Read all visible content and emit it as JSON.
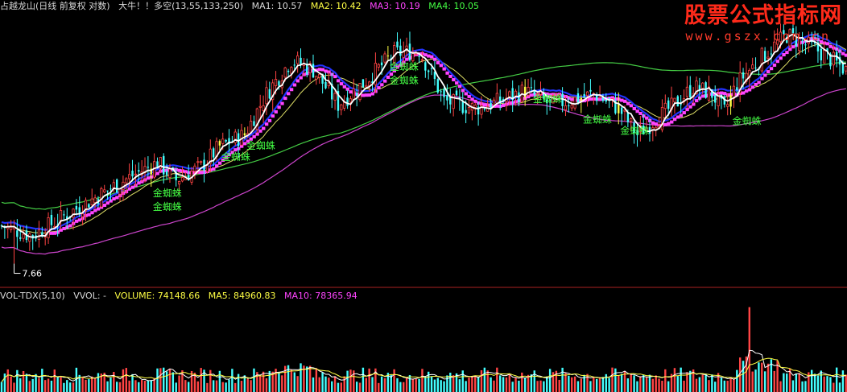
{
  "header": {
    "title": "占越龙山(日线 前复权 对数)",
    "indicator_name": "大牛！！多空(13,55,133,250)",
    "ma1": "MA1: 10.57",
    "ma2": "MA2: 10.42",
    "ma3": "MA3: 10.19",
    "ma4": "MA4: 10.05"
  },
  "volume_header": {
    "name": "VOL-TDX(5,10)",
    "vvol": "VVOL: -",
    "volume": "VOLUME: 74148.66",
    "ma5": "MA5: 84960.83",
    "ma10": "MA10: 78365.94"
  },
  "watermark": {
    "brand": "股票公式指标网",
    "url": "www.gszx.com.cn"
  },
  "colors": {
    "background": "#000000",
    "up": "#ff4444",
    "down": "#44ffff",
    "signal_bar": "#ffff44",
    "signal_text": "#44ff44",
    "ma_fast": "#ffffff",
    "band": "#ff44ff",
    "ma_blue": "#2233ff",
    "ma_yellow": "#dddd66",
    "ma_green": "#44cc44",
    "ma_magenta": "#cc44cc",
    "separator": "#aa2222"
  },
  "chart_data": {
    "type": "candlestick",
    "scale": "log",
    "price_range": [
      7.3,
      14.2
    ],
    "low_label": "7.66",
    "signal_label": "金蜘蛛",
    "close_anchors": [
      [
        0,
        8.4
      ],
      [
        10,
        8.2
      ],
      [
        20,
        8.6
      ],
      [
        30,
        9.0
      ],
      [
        42,
        9.5
      ],
      [
        50,
        9.8
      ],
      [
        56,
        9.4
      ],
      [
        64,
        9.7
      ],
      [
        70,
        10.2
      ],
      [
        78,
        10.5
      ],
      [
        85,
        11.6
      ],
      [
        93,
        12.6
      ],
      [
        100,
        12.3
      ],
      [
        108,
        11.3
      ],
      [
        116,
        11.9
      ],
      [
        126,
        12.8
      ],
      [
        134,
        12.9
      ],
      [
        142,
        11.4
      ],
      [
        152,
        11.2
      ],
      [
        160,
        11.4
      ],
      [
        168,
        11.7
      ],
      [
        176,
        11.3
      ],
      [
        182,
        11.4
      ],
      [
        190,
        11.6
      ],
      [
        198,
        11.2
      ],
      [
        204,
        10.5
      ],
      [
        210,
        10.9
      ],
      [
        216,
        11.3
      ],
      [
        222,
        11.8
      ],
      [
        228,
        11.6
      ],
      [
        232,
        11.1
      ],
      [
        236,
        11.9
      ],
      [
        244,
        12.7
      ],
      [
        252,
        13.4
      ],
      [
        262,
        12.9
      ],
      [
        271,
        12.3
      ]
    ],
    "signal_days": [
      48,
      70,
      78,
      124,
      168,
      186,
      198,
      234
    ],
    "signal_labels_days": [
      48,
      48,
      70,
      78,
      124,
      124,
      170,
      186,
      198,
      234
    ],
    "volume_range": [
      0,
      400000
    ],
    "volume_spike_day": 240,
    "volume_spike_value": 380000,
    "series": [
      {
        "name": "MA1",
        "value": 10.57
      },
      {
        "name": "MA2",
        "value": 10.42
      },
      {
        "name": "MA3",
        "value": 10.19
      },
      {
        "name": "MA4",
        "value": 10.05
      },
      {
        "name": "VOLUME",
        "value": 74148.66
      },
      {
        "name": "MA5",
        "value": 84960.83
      },
      {
        "name": "MA10",
        "value": 78365.94
      }
    ]
  }
}
